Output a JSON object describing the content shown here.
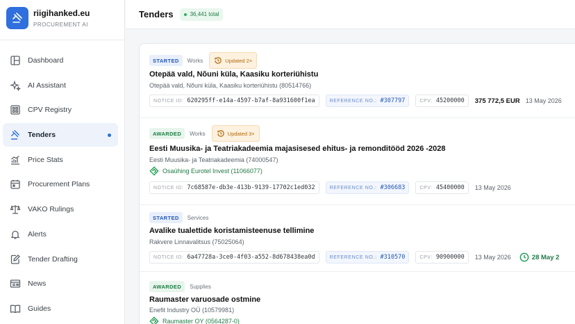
{
  "brand": {
    "name": "riigihanked.eu",
    "subtitle": "PROCUREMENT AI"
  },
  "sidebar": {
    "items": [
      {
        "label": "Dashboard",
        "icon": "layout-icon"
      },
      {
        "label": "AI Assistant",
        "icon": "sparkles-icon"
      },
      {
        "label": "CPV Registry",
        "icon": "grid-icon"
      },
      {
        "label": "Tenders",
        "icon": "gavel-icon",
        "active": true
      },
      {
        "label": "Price Stats",
        "icon": "chart-icon"
      },
      {
        "label": "Procurement Plans",
        "icon": "calendar-icon"
      },
      {
        "label": "VAKO Rulings",
        "icon": "scale-icon"
      },
      {
        "label": "Alerts",
        "icon": "bell-icon"
      },
      {
        "label": "Tender Drafting",
        "icon": "edit-icon"
      },
      {
        "label": "News",
        "icon": "newspaper-icon"
      },
      {
        "label": "Guides",
        "icon": "book-icon"
      }
    ]
  },
  "header": {
    "title": "Tenders",
    "total": "36,441 total"
  },
  "labels": {
    "notice": "NOTICE ID:",
    "reference": "REFERENCE NO.:",
    "cpv": "CPV:"
  },
  "tenders": [
    {
      "status": "STARTED",
      "status_class": "started",
      "type": "Works",
      "updated": "Updated 2×",
      "title": "Otepää vald, Nõuni küla, Kaasiku korteriühistu",
      "buyer": "Otepää vald, Nõuni küla, Kaasiku korteriühistu (80514766)",
      "notice_id": "620295ff-e14a-4597-b7af-8a931600f1ea",
      "reference": "#307797",
      "cpv": "45200000",
      "amount": "375 772,5 EUR",
      "date": "13 May 2026"
    },
    {
      "status": "AWARDED",
      "status_class": "awarded",
      "type": "Works",
      "updated": "Updated 3×",
      "title": "Eesti Muusika- ja Teatriakadeemia majasisesed ehitus- ja remonditööd 2026 -2028",
      "buyer": "Eesti Muusika- ja Teatriakadeemia (74000547)",
      "winner": "Osaühing Eurotel Invest (11066077)",
      "notice_id": "7c68587e-db3e-413b-9139-17702c1ed032",
      "reference": "#306683",
      "cpv": "45400000",
      "date": "13 May 2026"
    },
    {
      "status": "STARTED",
      "status_class": "started",
      "type": "Services",
      "title": "Avalike tualettide koristamisteenuse tellimine",
      "buyer": "Rakvere Linnavalitsus (75025064)",
      "notice_id": "6a47728a-3ce0-4f03-a552-8d678438ea0d",
      "reference": "#310570",
      "cpv": "90900000",
      "date": "13 May 2026",
      "deadline": "28 May 2"
    },
    {
      "status": "AWARDED",
      "status_class": "awarded",
      "type": "Supplies",
      "title": "Raumaster varuosade ostmine",
      "buyer": "Enefit Industry OÜ (10579981)",
      "winner": "Raumaster OY (0564287-0)"
    }
  ],
  "colors": {
    "accent": "#2f6fde",
    "green": "#1f7a45",
    "orange": "#b06a10"
  }
}
